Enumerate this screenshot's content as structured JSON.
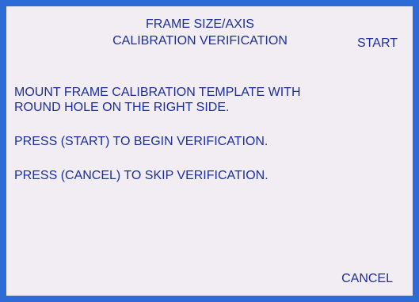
{
  "header": {
    "title_line1": "FRAME SIZE/AXIS",
    "title_line2": "CALIBRATION VERIFICATION"
  },
  "softkeys": {
    "start": "START",
    "cancel": "CANCEL"
  },
  "messages": [
    "MOUNT FRAME CALIBRATION TEMPLATE WITH",
    "ROUND HOLE ON THE RIGHT SIDE.",
    "PRESS (START) TO BEGIN VERIFICATION.",
    "PRESS (CANCEL) TO SKIP VERIFICATION."
  ],
  "colors": {
    "border": "#2f6bd6",
    "background": "#f1edf3",
    "text": "#1c2f9c"
  }
}
